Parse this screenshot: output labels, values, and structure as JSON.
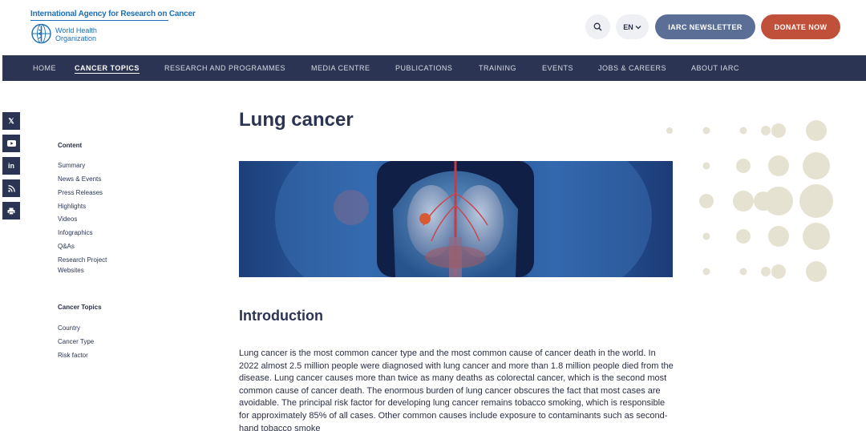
{
  "header": {
    "logo_line1": "International Agency for Research on Cancer",
    "logo_who_line1": "World Health",
    "logo_who_line2": "Organization",
    "language": "EN",
    "newsletter_label": "IARC NEWSLETTER",
    "donate_label": "DONATE NOW",
    "accent": "#1e6fb3",
    "newsletter_color": "#5a6e96",
    "donate_color": "#c0503a"
  },
  "nav": {
    "bg_color": "#2b3553",
    "items": [
      {
        "label": "HOME"
      },
      {
        "label": "CANCER TOPICS",
        "active": true
      },
      {
        "label": "RESEARCH AND PROGRAMMES"
      },
      {
        "label": "MEDIA CENTRE"
      },
      {
        "label": "PUBLICATIONS"
      },
      {
        "label": "TRAINING"
      },
      {
        "label": "EVENTS"
      },
      {
        "label": "JOBS & CAREERS"
      },
      {
        "label": "ABOUT IARC"
      }
    ]
  },
  "social": [
    {
      "icon": "x-icon",
      "glyph": "𝕏"
    },
    {
      "icon": "youtube-icon",
      "glyph": "▶"
    },
    {
      "icon": "linkedin-icon",
      "glyph": "in"
    },
    {
      "icon": "rss-icon",
      "glyph": "◉"
    },
    {
      "icon": "print-icon",
      "glyph": "▤"
    }
  ],
  "sidebar": {
    "content_heading": "Content",
    "content_links": [
      "Summary",
      "News & Events",
      "Press Releases",
      "Highlights",
      "Videos",
      "Infographics",
      "Q&As",
      "Research Project",
      "Websites"
    ],
    "topics_heading": "Cancer Topics",
    "topics_links": [
      "Country",
      "Cancer Type",
      "Risk factor"
    ]
  },
  "main": {
    "title": "Lung cancer",
    "section_title": "Introduction",
    "paragraph": "Lung cancer is the most common cancer type and the most common cause of cancer death in the world. In 2022 almost 2.5 million people were diagnosed with lung cancer and more than 1.8 million people died from the disease. Lung cancer causes more than twice as many deaths as colorectal cancer, which is the second most common cause of cancer death. The enormous burden of lung cancer obscures the fact that most cases are avoidable. The principal risk factor for developing lung cancer remains tobacco smoking, which is responsible for approximately 85% of all cases. Other common causes include exposure to contaminants such as second-hand tobacco smoke"
  }
}
